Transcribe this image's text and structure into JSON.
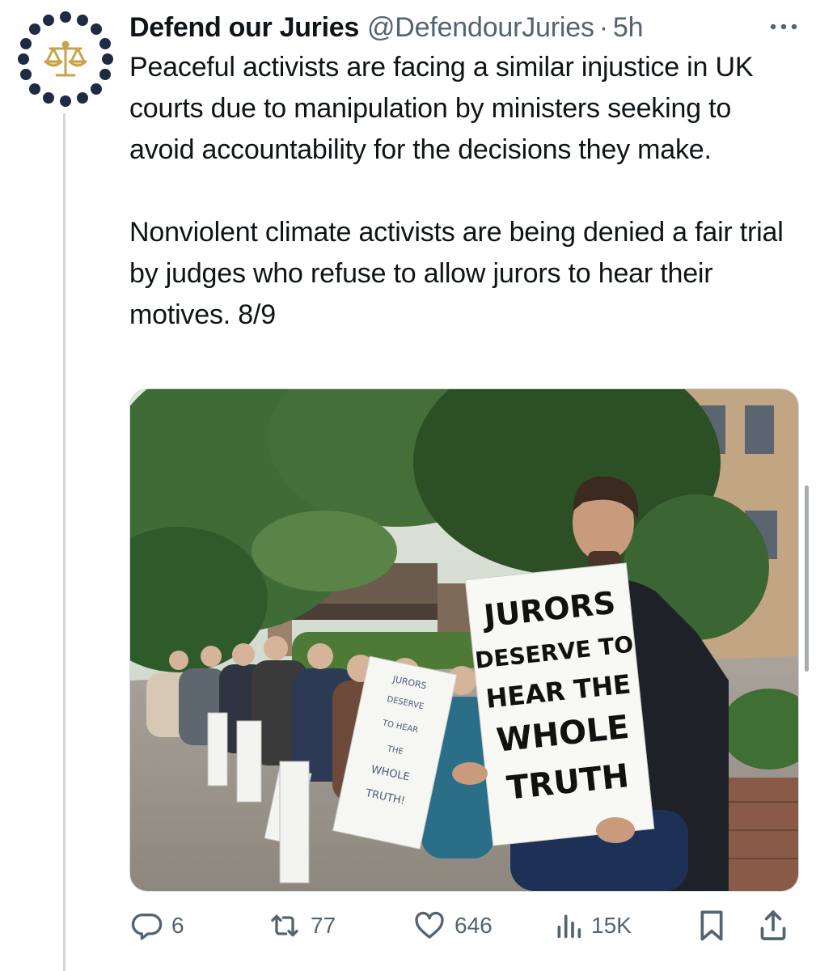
{
  "tweet": {
    "display_name": "Defend our Juries",
    "handle": "@DefendourJuries",
    "separator": "·",
    "timestamp": "5h",
    "paragraphs": [
      "Peaceful activists are facing a similar injustice in UK courts due to manipulation by ministers seeking to avoid accountability for the decisions they make.",
      "Nonviolent climate activists are being denied a fair trial by judges who refuse to allow jurors to hear their motives. 8/9"
    ],
    "avatar_icon": "scales-of-justice-icon",
    "avatar_accent": "#c9a24a",
    "avatar_dot_color": "#1f2a44"
  },
  "media": {
    "placard_main_lines": [
      "JURORS",
      "DESERVE TO",
      "HEAR THE",
      "WHOLE",
      "TRUTH"
    ],
    "placard_second_lines": [
      "JURORS",
      "DESERVE",
      "TO HEAR",
      "THE",
      "WHOLE",
      "TRUTH!"
    ]
  },
  "actions": {
    "replies": {
      "icon": "reply-icon",
      "count": "6"
    },
    "reposts": {
      "icon": "repost-icon",
      "count": "77"
    },
    "likes": {
      "icon": "like-icon",
      "count": "646"
    },
    "views": {
      "icon": "views-icon",
      "count": "15K"
    },
    "bookmark": {
      "icon": "bookmark-icon"
    },
    "share": {
      "icon": "share-icon"
    }
  },
  "colors": {
    "text_primary": "#0f1419",
    "text_secondary": "#536471",
    "thread_line": "#cfd9de"
  }
}
